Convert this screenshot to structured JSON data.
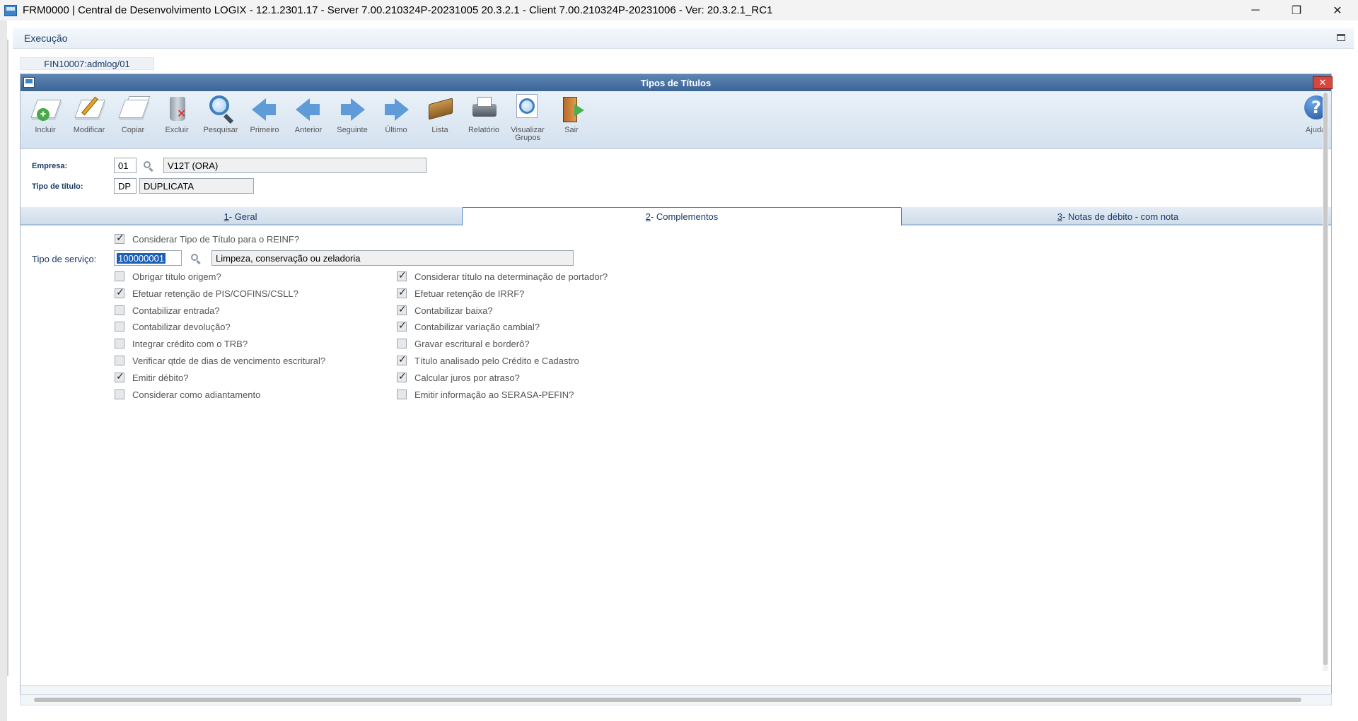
{
  "window": {
    "title": "FRM0000 | Central de Desenvolvimento LOGIX  -  12.1.2301.17 - Server 7.00.210324P-20231005 20.3.2.1 - Client 7.00.210324P-20231006 - Ver: 20.3.2.1_RC1",
    "minimize": "─",
    "restore": "❐",
    "close": "✕"
  },
  "menu": {
    "execucao": "Execução"
  },
  "doc_tab": {
    "label": "FIN10007:admlog/01"
  },
  "form": {
    "title": "Tipos de Títulos",
    "close": "✕"
  },
  "toolbar": {
    "incluir": "Incluir",
    "modificar": "Modificar",
    "copiar": "Copiar",
    "excluir": "Excluir",
    "pesquisar": "Pesquisar",
    "primeiro": "Primeiro",
    "anterior": "Anterior",
    "seguinte": "Seguinte",
    "ultimo": "Último",
    "lista": "Lista",
    "relatorio": "Relatório",
    "visualizar_grupos_1": "Visualizar",
    "visualizar_grupos_2": "Grupos",
    "sair": "Sair",
    "ajuda": "Ajuda",
    "help_glyph": "?"
  },
  "header": {
    "empresa_label": "Empresa:",
    "empresa_code": "01",
    "empresa_desc": "V12T (ORA)",
    "tipo_label": "Tipo de título:",
    "tipo_code": "DP",
    "tipo_desc": "DUPLICATA"
  },
  "tabs": {
    "geral_key": "1",
    "geral": " - Geral",
    "complementos_key": "2",
    "complementos": " - Complementos",
    "notas_key": "3",
    "notas": " - Notas de débito - com nota"
  },
  "content": {
    "reinf": {
      "label": "Considerar Tipo de Título para o REINF?",
      "checked": true
    },
    "servico_label": "Tipo de serviço:",
    "servico_code": "100000001",
    "servico_desc": "Limpeza, conservação ou zeladoria",
    "left": [
      {
        "label": "Obrigar título origem?",
        "checked": false
      },
      {
        "label": "Efetuar retenção de PIS/COFINS/CSLL?",
        "checked": true
      },
      {
        "label": "Contabilizar entrada?",
        "checked": false
      },
      {
        "label": "Contabilizar devolução?",
        "checked": false
      },
      {
        "label": "Integrar crédito com o TRB?",
        "checked": false
      },
      {
        "label": "Verificar qtde de dias de vencimento escritural?",
        "checked": false
      },
      {
        "label": "Emitir débito?",
        "checked": true
      },
      {
        "label": "Considerar como adiantamento",
        "checked": false
      }
    ],
    "right": [
      {
        "label": "Considerar título na determinação de portador?",
        "checked": true
      },
      {
        "label": "Efetuar retenção de IRRF?",
        "checked": true
      },
      {
        "label": "Contabilizar baixa?",
        "checked": true
      },
      {
        "label": "Contabilizar variação cambial?",
        "checked": true
      },
      {
        "label": "Gravar escritural e borderô?",
        "checked": false
      },
      {
        "label": "Título analisado pelo Crédito e Cadastro",
        "checked": true
      },
      {
        "label": "Calcular juros por atraso?",
        "checked": true
      },
      {
        "label": "Emitir informação ao SERASA-PEFIN?",
        "checked": false
      }
    ]
  },
  "colors": {
    "accent": "#3b6597",
    "label_blue": "#1a3a66",
    "selection": "#1b5fb8"
  }
}
